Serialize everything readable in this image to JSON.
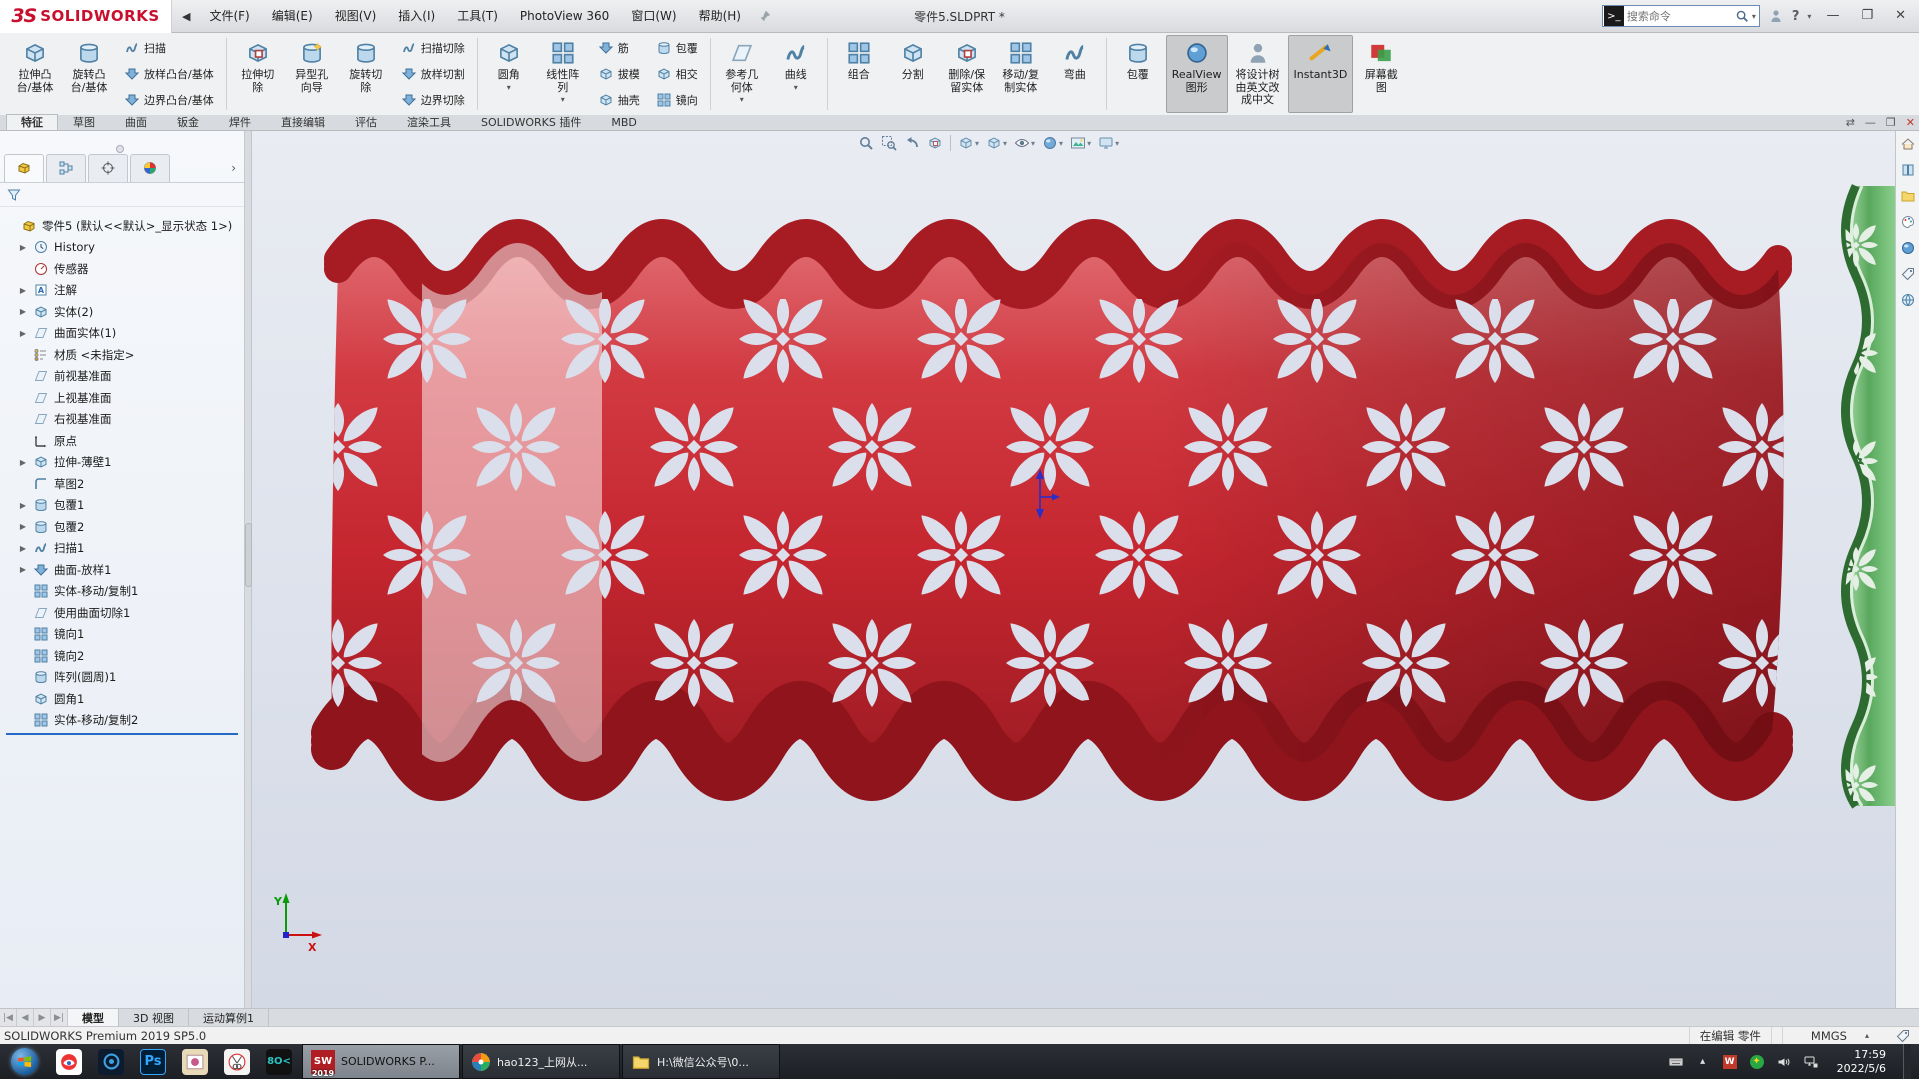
{
  "titlebar": {
    "logo_prefix": "3S",
    "logo_text": "SOLIDWORKS",
    "menus": [
      {
        "id": "file",
        "label": "文件(F)"
      },
      {
        "id": "edit",
        "label": "编辑(E)"
      },
      {
        "id": "view",
        "label": "视图(V)"
      },
      {
        "id": "insert",
        "label": "插入(I)"
      },
      {
        "id": "tools",
        "label": "工具(T)"
      },
      {
        "id": "photoview-360",
        "label": "PhotoView 360"
      },
      {
        "id": "window",
        "label": "窗口(W)"
      },
      {
        "id": "help",
        "label": "帮助(H)"
      }
    ],
    "document_title": "零件5.SLDPRT *",
    "search_placeholder": "搜索命令"
  },
  "ribbon": {
    "tabs": [
      {
        "id": "features",
        "label": "特征",
        "active": true
      },
      {
        "id": "sketch",
        "label": "草图"
      },
      {
        "id": "surfaces",
        "label": "曲面"
      },
      {
        "id": "sheet-metal",
        "label": "钣金"
      },
      {
        "id": "weldments",
        "label": "焊件"
      },
      {
        "id": "direct-editing",
        "label": "直接编辑"
      },
      {
        "id": "evaluate",
        "label": "评估"
      },
      {
        "id": "render-tools",
        "label": "渲染工具"
      },
      {
        "id": "solidworks-addins",
        "label": "SOLIDWORKS 插件"
      },
      {
        "id": "mbd",
        "label": "MBD"
      }
    ],
    "groups": [
      {
        "cols": [
          {
            "type": "big",
            "label": "拉伸凸\n台/基体",
            "icon": "extrude-boss-icon"
          },
          {
            "type": "big",
            "label": "旋转凸\n台/基体",
            "icon": "revolve-boss-icon"
          },
          {
            "type": "stack",
            "items": [
              {
                "label": "扫描",
                "icon": "sweep-icon"
              },
              {
                "label": "放样凸台/基体",
                "icon": "loft-boss-icon"
              },
              {
                "label": "边界凸台/基体",
                "icon": "boundary-boss-icon"
              }
            ]
          }
        ]
      },
      {
        "cols": [
          {
            "type": "big",
            "label": "拉伸切\n除",
            "icon": "extruded-cut-icon"
          },
          {
            "type": "big",
            "label": "异型孔\n向导",
            "icon": "hole-wizard-icon"
          },
          {
            "type": "big",
            "label": "旋转切\n除",
            "icon": "revolved-cut-icon"
          },
          {
            "type": "stack",
            "items": [
              {
                "label": "扫描切除",
                "icon": "swept-cut-icon"
              },
              {
                "label": "放样切割",
                "icon": "lofted-cut-icon"
              },
              {
                "label": "边界切除",
                "icon": "boundary-cut-icon"
              }
            ]
          }
        ]
      },
      {
        "cols": [
          {
            "type": "big",
            "label": "圆角",
            "icon": "fillet-icon",
            "caret": true
          },
          {
            "type": "big",
            "label": "线性阵\n列",
            "icon": "linear-pattern-icon",
            "caret": true
          },
          {
            "type": "stack",
            "items": [
              {
                "label": "筋",
                "icon": "rib-icon"
              },
              {
                "label": "拔模",
                "icon": "draft-icon"
              },
              {
                "label": "抽壳",
                "icon": "shell-icon"
              }
            ]
          },
          {
            "type": "stack",
            "items": [
              {
                "label": "包覆",
                "icon": "wrap-icon"
              },
              {
                "label": "相交",
                "icon": "intersect-icon"
              },
              {
                "label": "镜向",
                "icon": "mirror-icon"
              }
            ]
          }
        ]
      },
      {
        "cols": [
          {
            "type": "big",
            "label": "参考几\n何体",
            "icon": "reference-geometry-icon",
            "caret": true
          },
          {
            "type": "big",
            "label": "曲线",
            "icon": "curves-icon",
            "caret": true
          }
        ]
      },
      {
        "cols": [
          {
            "type": "big",
            "label": "组合",
            "icon": "combine-icon"
          },
          {
            "type": "big",
            "label": "分割",
            "icon": "split-icon"
          },
          {
            "type": "big",
            "label": "删除/保\n留实体",
            "icon": "delete-keep-body-icon"
          },
          {
            "type": "big",
            "label": "移动/复\n制实体",
            "icon": "move-copy-body-icon"
          },
          {
            "type": "big",
            "label": "弯曲",
            "icon": "flex-icon"
          }
        ]
      },
      {
        "cols": [
          {
            "type": "big",
            "label": "包覆",
            "icon": "wrap-icon"
          },
          {
            "type": "big",
            "label": "RealView\n图形",
            "icon": "realview-icon",
            "toggled": true
          },
          {
            "type": "big",
            "label": "将设计树\n由英文改\n成中文",
            "icon": "tree-language-icon"
          },
          {
            "type": "big",
            "label": "Instant3D",
            "icon": "instant3d-icon",
            "toggled": true
          },
          {
            "type": "big",
            "label": "屏幕截\n图",
            "icon": "screen-capture-icon"
          }
        ]
      }
    ]
  },
  "feature_tree": {
    "root": "零件5 (默认<<默认>_显示状态 1>)",
    "items": [
      {
        "id": "history",
        "label": "History",
        "icon": "history-icon",
        "expand": true
      },
      {
        "id": "sensors",
        "label": "传感器",
        "icon": "sensors-icon"
      },
      {
        "id": "annotations",
        "label": "注解",
        "icon": "annotations-icon",
        "expand": true
      },
      {
        "id": "solid-bodies",
        "label": "实体(2)",
        "icon": "solid-bodies-icon",
        "expand": true
      },
      {
        "id": "surface-bodies",
        "label": "曲面实体(1)",
        "icon": "surface-bodies-icon",
        "expand": true
      },
      {
        "id": "material",
        "label": "材质 <未指定>",
        "icon": "material-icon"
      },
      {
        "id": "front-plane",
        "label": "前视基准面",
        "icon": "plane-icon"
      },
      {
        "id": "top-plane",
        "label": "上视基准面",
        "icon": "plane-icon"
      },
      {
        "id": "right-plane",
        "label": "右视基准面",
        "icon": "plane-icon"
      },
      {
        "id": "origin",
        "label": "原点",
        "icon": "origin-icon"
      },
      {
        "id": "extrude-thin1",
        "label": "拉伸-薄壁1",
        "icon": "extrude-icon",
        "expand": true
      },
      {
        "id": "sketch2",
        "label": "草图2",
        "icon": "sketch-icon"
      },
      {
        "id": "wrap1",
        "label": "包覆1",
        "icon": "wrap-icon",
        "expand": true
      },
      {
        "id": "wrap2",
        "label": "包覆2",
        "icon": "wrap-icon",
        "expand": true
      },
      {
        "id": "sweep1",
        "label": "扫描1",
        "icon": "sweep-icon",
        "expand": true
      },
      {
        "id": "surface-loft1",
        "label": "曲面-放样1",
        "icon": "loft-icon",
        "expand": true
      },
      {
        "id": "body-move-copy1",
        "label": "实体-移动/复制1",
        "icon": "move-copy-icon"
      },
      {
        "id": "cut-with-surface1",
        "label": "使用曲面切除1",
        "icon": "cut-surface-icon"
      },
      {
        "id": "mirror1",
        "label": "镜向1",
        "icon": "mirror-icon"
      },
      {
        "id": "mirror2",
        "label": "镜向2",
        "icon": "mirror-icon"
      },
      {
        "id": "circular-pattern1",
        "label": "阵列(圆周)1",
        "icon": "circular-pattern-icon"
      },
      {
        "id": "fillet1",
        "label": "圆角1",
        "icon": "fillet-icon"
      },
      {
        "id": "body-move-copy2",
        "label": "实体-移动/复制2",
        "icon": "move-copy-icon"
      }
    ]
  },
  "viewport": {
    "headsup_icons": [
      {
        "name": "zoom-fit-icon"
      },
      {
        "name": "zoom-area-icon"
      },
      {
        "name": "previous-view-icon"
      },
      {
        "name": "section-view-icon",
        "sep_after": true
      },
      {
        "name": "view-orientation-icon",
        "caret": true
      },
      {
        "name": "display-style-icon",
        "caret": true
      },
      {
        "name": "hide-show-items-icon",
        "caret": true
      },
      {
        "name": "edit-appearance-icon",
        "caret": true
      },
      {
        "name": "apply-scene-icon",
        "caret": true
      },
      {
        "name": "view-settings-icon",
        "caret": true
      }
    ],
    "triad": {
      "x_label": "X",
      "y_label": "Y"
    }
  },
  "task_pane_icons": [
    "resources-home-icon",
    "design-library-icon",
    "file-explorer-icon",
    "view-palette-icon",
    "appearances-icon",
    "custom-properties-icon",
    "forum-icon"
  ],
  "doc_tabs": [
    {
      "id": "model",
      "label": "模型",
      "active": true
    },
    {
      "id": "3d-views",
      "label": "3D 视图"
    },
    {
      "id": "motion-study-1",
      "label": "运动算例1"
    }
  ],
  "statusbar": {
    "product": "SOLIDWORKS Premium 2019 SP5.0",
    "editing": "在编辑 零件",
    "units": "MMGS"
  },
  "taskbar": {
    "apps": [
      {
        "id": "baidu-netdisk"
      },
      {
        "id": "dark-browser"
      },
      {
        "id": "photoshop",
        "glyph": "Ps"
      },
      {
        "id": "photos"
      },
      {
        "id": "screenshot-tool"
      },
      {
        "id": "image-tool"
      }
    ],
    "windows": [
      {
        "id": "solidworks",
        "label": "SOLIDWORKS P...",
        "badge": "2019",
        "active": true
      },
      {
        "id": "hao123",
        "label": "hao123_上网从..."
      },
      {
        "id": "explorer",
        "label": "H:\\微信公众号\\0..."
      }
    ],
    "tray_icons": [
      "touch-keyboard-icon",
      "tray-expand-icon",
      "red-app-tray-icon",
      "green-app-tray-icon",
      "speaker-icon",
      "network-icon"
    ],
    "clock": {
      "time": "17:59",
      "date": "2022/5/6"
    }
  }
}
